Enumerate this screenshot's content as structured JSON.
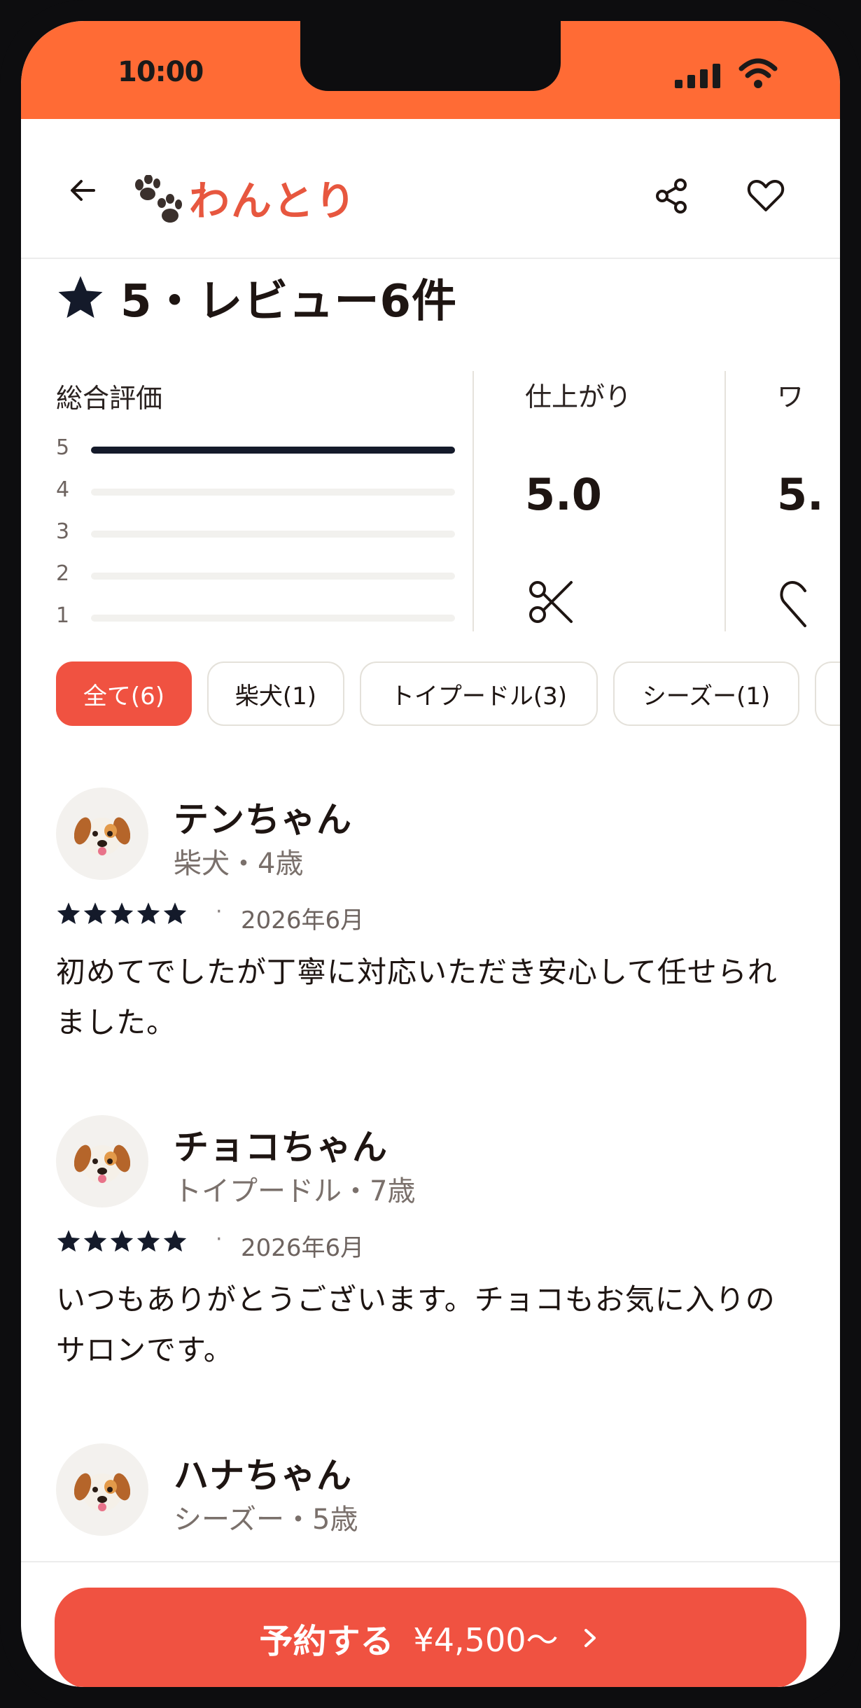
{
  "status_bar": {
    "time": "10:00"
  },
  "header": {
    "app_name": "わんとり"
  },
  "rating": {
    "title": "5・レビュー6件"
  },
  "overall": {
    "label": "総合評価",
    "bars": [
      {
        "star": "5",
        "fraction": 1.0
      },
      {
        "star": "4",
        "fraction": 0.0
      },
      {
        "star": "3",
        "fraction": 0.0
      },
      {
        "star": "2",
        "fraction": 0.0
      },
      {
        "star": "1",
        "fraction": 0.0
      }
    ]
  },
  "categories": [
    {
      "label": "仕上がり",
      "value": "5.0",
      "icon": "scissors-icon"
    },
    {
      "label": "ワ",
      "value": "5.",
      "icon": "heart-partial-icon"
    }
  ],
  "filters": [
    "全て(6)",
    "柴犬(1)",
    "トイプードル(3)",
    "シーズー(1)"
  ],
  "reviews": [
    {
      "name": "テンちゃん",
      "meta": "柴犬・4歳",
      "stars": 5,
      "date": "2026年6月",
      "text": "初めてでしたが丁寧に対応いただき安心して任せられました。"
    },
    {
      "name": "チョコちゃん",
      "meta": "トイプードル・7歳",
      "stars": 5,
      "date": "2026年6月",
      "text": "いつもありがとうございます。チョコもお気に入りのサロンです。"
    },
    {
      "name": "ハナちゃん",
      "meta": "シーズー・5歳"
    }
  ],
  "cta": {
    "label": "予約する",
    "price": "¥4,500〜"
  },
  "colors": {
    "status_bar": "#ff6b35",
    "accent": "#f05241",
    "logo": "#e7573f",
    "star": "#141a2a"
  }
}
